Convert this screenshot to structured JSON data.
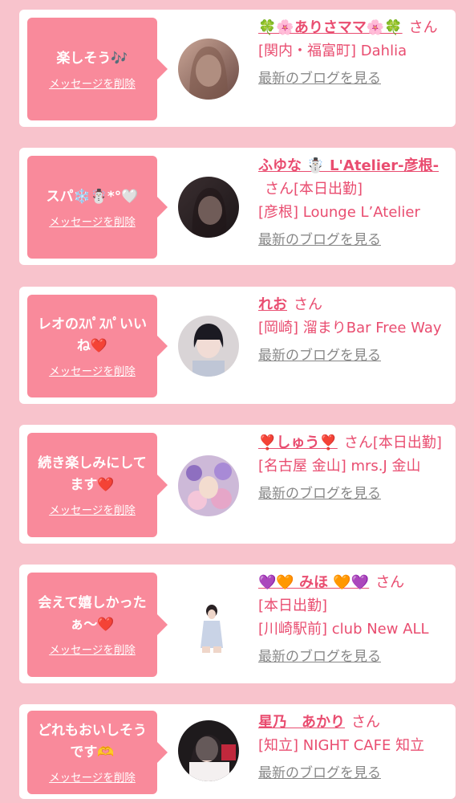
{
  "colors": {
    "background": "#f8c3cc",
    "card": "#ffffff",
    "bubble": "#f98a9b",
    "accent_text": "#e94d70",
    "link_gray": "#888888"
  },
  "delete_label": "メッセージを削除",
  "blog_label": "最新のブログを見る",
  "items": [
    {
      "message_line1": "楽しそう🎶",
      "message_line2": "",
      "name": "🍀🌸ありさママ🌸🍀",
      "san": "さん",
      "status": "",
      "shop": "[関内・福富町] Dahlia"
    },
    {
      "message_line1": "スパ❄️☃️*°🤍",
      "message_line2": "",
      "name": "ふゆな ☃️ L'Atelier-彦根-",
      "san": "さん",
      "status": "[本日出勤]",
      "shop": "[彦根] Lounge L’Atelier"
    },
    {
      "message_line1": "レオのｽﾊﾟｽﾊﾟいい",
      "message_line2": "ね❤️",
      "name": "れお",
      "san": "さん",
      "status": "",
      "shop": "[岡崎] 溜まりBar Free Way"
    },
    {
      "message_line1": "続き楽しみにして",
      "message_line2": "ます❤️",
      "name": "❣️しゅう❣️",
      "san": "さん",
      "status": "[本日出勤]",
      "shop": "[名古屋 金山] mrs.J 金山"
    },
    {
      "message_line1": "会えて嬉しかった",
      "message_line2": "ぁ〜❤️",
      "name": "💜🧡 みほ 🧡💜",
      "san": "さん",
      "status": "[本日出勤]",
      "shop": "[川崎駅前] club New ALL"
    },
    {
      "message_line1": "どれもおいしそう",
      "message_line2": "です🫶",
      "name": "星乃　あかり",
      "san": "さん",
      "status": "",
      "shop": "[知立] NIGHT CAFE 知立"
    }
  ]
}
